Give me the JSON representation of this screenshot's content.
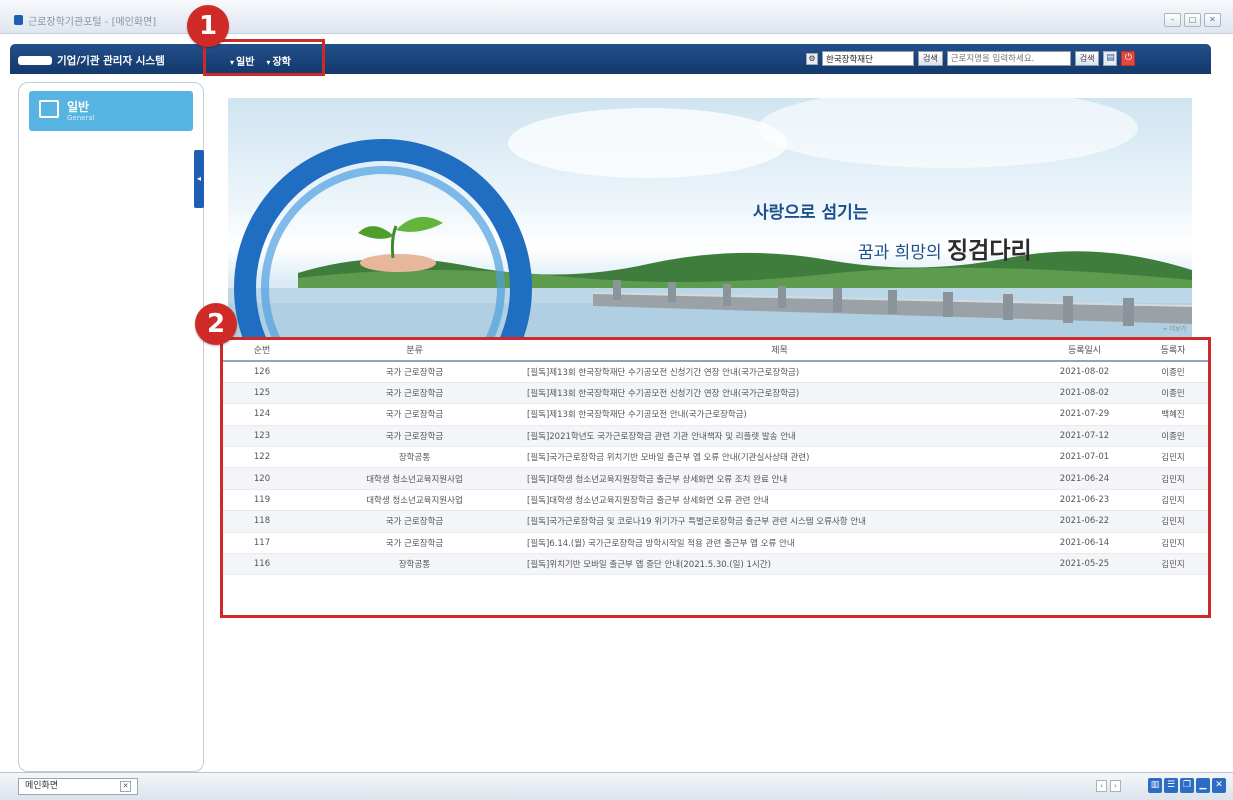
{
  "window": {
    "title": "근로장학기관포털 - [메인화면]"
  },
  "navbar": {
    "system_title": "기업/기관 관리자 시스템",
    "menu": [
      "일반",
      "장학"
    ],
    "search_org_value": "한국장학재단",
    "search_btn_label": "검색",
    "search_place_placeholder": "근로지명을 입력하세요.",
    "search_btn2_label": "검색"
  },
  "sidebar": {
    "tab_label": "일반",
    "tab_sublabel": "General"
  },
  "callouts": [
    "1",
    "2"
  ],
  "banner": {
    "line1": "사랑으로 섬기는",
    "line2_prefix": "꿈과 희망의",
    "line2_emphasis": "징검다리",
    "more": "+ 더보기"
  },
  "notice_table": {
    "columns": [
      "순번",
      "분류",
      "제목",
      "등록일시",
      "등록자"
    ],
    "rows": [
      [
        "126",
        "국가 근로장학금",
        "[필독]제13회 한국장학재단 수기공모전 신청기간 연장 안내(국가근로장학금)",
        "2021-08-02",
        "이종민"
      ],
      [
        "125",
        "국가 근로장학금",
        "[필독]제13회 한국장학재단 수기공모전 신청기간 연장 안내(국가근로장학금)",
        "2021-08-02",
        "이종민"
      ],
      [
        "124",
        "국가 근로장학금",
        "[필독]제13회 한국장학재단 수기공모전 안내(국가근로장학금)",
        "2021-07-29",
        "백혜진"
      ],
      [
        "123",
        "국가 근로장학금",
        "[필독]2021학년도 국가근로장학금 관련 기관 안내책자 및 리플렛 발송 안내",
        "2021-07-12",
        "이종민"
      ],
      [
        "122",
        "장학공통",
        "[필독]국가근로장학금 위치기반 모바일 출근부 앱 오류 안내(기관실사상태 관련)",
        "2021-07-01",
        "김민지"
      ],
      [
        "120",
        "대학생 청소년교육지원사업",
        "[필독]대학생 청소년교육지원장학금 출근부 상세화면 오류 조치 완료 안내",
        "2021-06-24",
        "김민지"
      ],
      [
        "119",
        "대학생 청소년교육지원사업",
        "[필독]대학생 청소년교육지원장학금 출근부 상세화면 오류 관련 안내",
        "2021-06-23",
        "김민지"
      ],
      [
        "118",
        "국가 근로장학금",
        "[필독]국가근로장학금 및 코로나19 위기가구 특별근로장학금 출근부 관련 시스템 오류사항 안내",
        "2021-06-22",
        "김민지"
      ],
      [
        "117",
        "국가 근로장학금",
        "[필독]6.14.(월) 국가근로장학금 방학시작일 적용 관련 출근부 앱 오류 안내",
        "2021-06-14",
        "김민지"
      ],
      [
        "116",
        "장학공통",
        "[필독]위치기반 모바일 출근부 앱 중단 안내(2021.5.30.(일) 1시간)",
        "2021-05-25",
        "김민지"
      ]
    ]
  },
  "statusbar": {
    "tab_label": "메인화면"
  },
  "colors": {
    "nav_blue": "#1a4479",
    "accent_red": "#cf2a27",
    "sidebar_tab": "#56b3e2"
  }
}
